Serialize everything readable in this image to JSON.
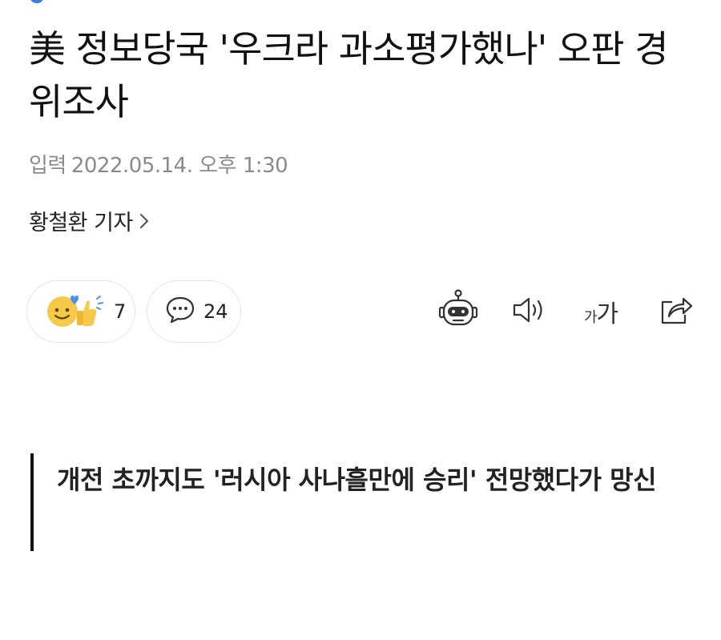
{
  "article": {
    "headline": "美 정보당국 '우크라 과소평가했나' 오판 경위조사",
    "published_label": "입력",
    "published_datetime": "2022.05.14. 오후 1:30",
    "reporter": "황철환 기자",
    "subheading": "개전 초까지도 '러시아 사나흘만에 승리' 전망했다가 망신"
  },
  "reactions": {
    "like_count": "7",
    "comment_count": "24"
  },
  "toolbar": {
    "font_small_glyph": "가",
    "font_large_glyph": "가"
  },
  "icons": {
    "reaction": "smiley-thumbs-up-icon",
    "comment": "speech-bubble-icon",
    "summary_bot": "robot-icon",
    "text_to_speech": "speaker-icon",
    "font_size": "font-size-icon",
    "share": "share-icon"
  },
  "colors": {
    "accent_blue": "#3a7ce0",
    "emoji_yellow": "#f7c948",
    "heart_blue": "#4a8ff0",
    "meta_gray": "#8a8a8a"
  }
}
